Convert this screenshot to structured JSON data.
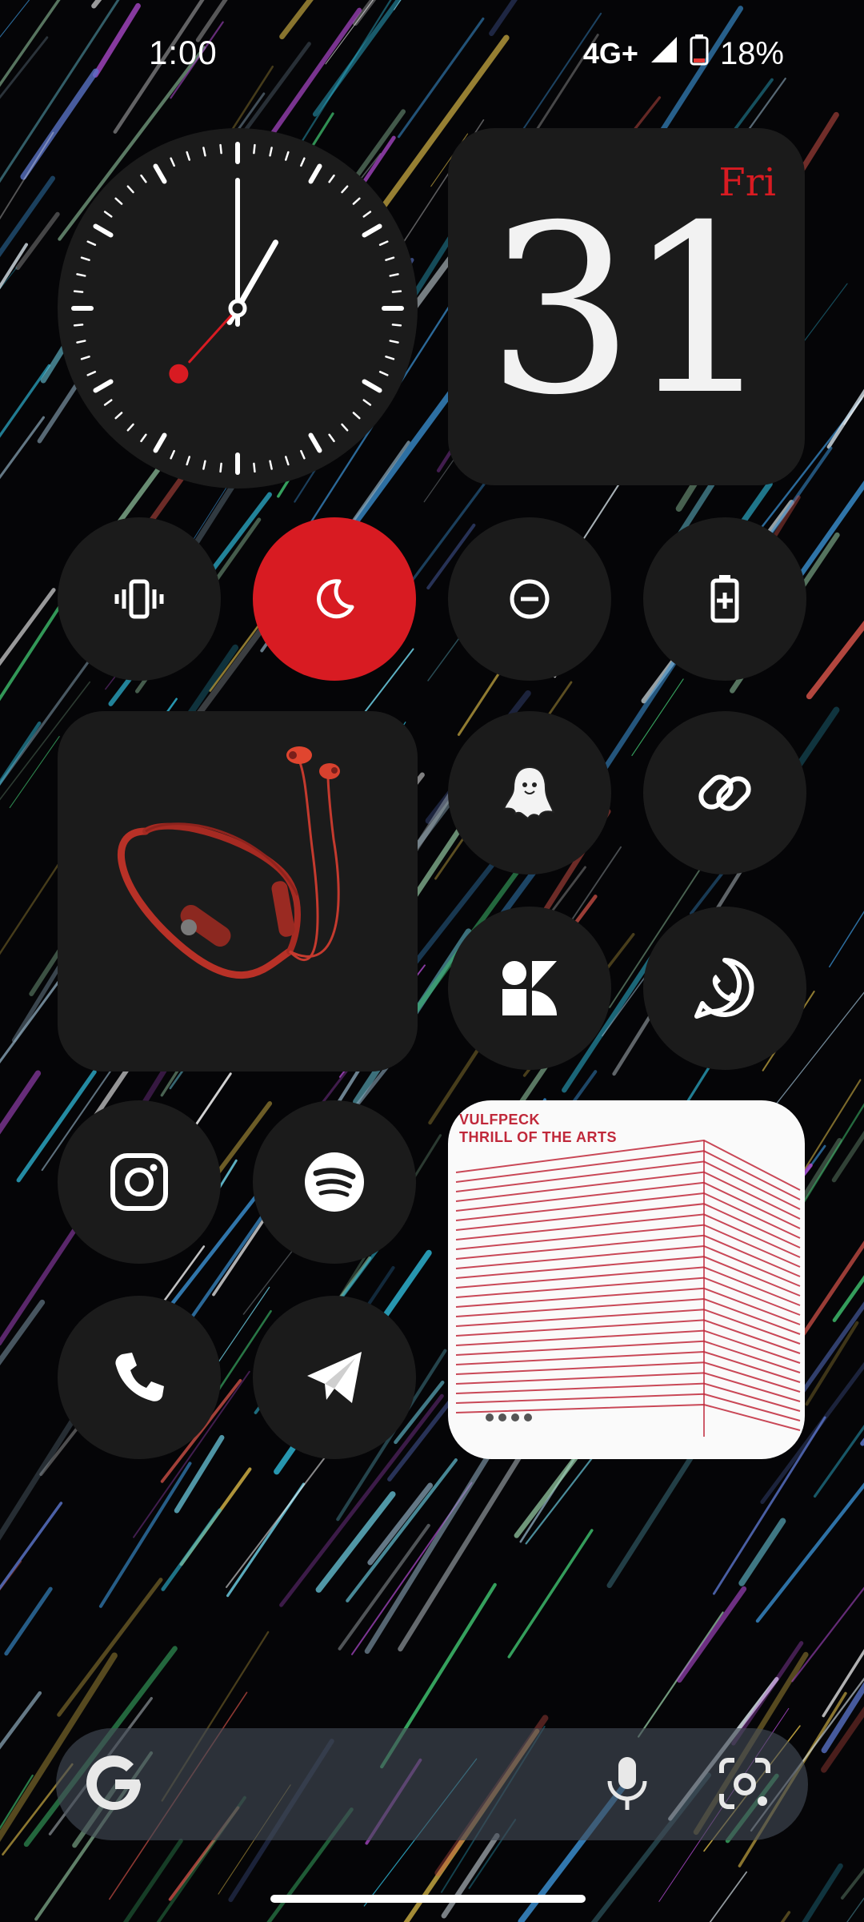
{
  "status_bar": {
    "time": "1:00",
    "network": "4G+",
    "battery": "18%"
  },
  "clock_widget": {
    "hours": 1,
    "minutes": 0,
    "seconds": 37,
    "accent_color": "#d81b22"
  },
  "date_widget": {
    "weekday": "Fri",
    "day": "31",
    "weekday_color": "#d81b22"
  },
  "quick_toggles": [
    {
      "name": "vibrate",
      "icon": "vibrate-icon",
      "active": false
    },
    {
      "name": "bedtime",
      "icon": "moon-icon",
      "active": true
    },
    {
      "name": "do-not-disturb",
      "icon": "minus-circle-icon",
      "active": false
    },
    {
      "name": "battery-saver",
      "icon": "battery-plus-icon",
      "active": false
    }
  ],
  "apps": [
    {
      "name": "ghost-app",
      "icon": "ghost-icon"
    },
    {
      "name": "clipboard-app",
      "icon": "link-icon"
    },
    {
      "name": "shapes-app",
      "icon": "shapes-icon"
    },
    {
      "name": "whatsapp",
      "icon": "whatsapp-icon"
    },
    {
      "name": "instagram",
      "icon": "instagram-icon"
    },
    {
      "name": "spotify",
      "icon": "spotify-icon"
    },
    {
      "name": "phone",
      "icon": "phone-icon"
    },
    {
      "name": "telegram",
      "icon": "telegram-icon"
    }
  ],
  "product_widget": {
    "image": "neckband-earphones",
    "color": "#c23a2e"
  },
  "album_widget": {
    "artist": "VULFPECK",
    "title": "THRILL OF THE ARTS",
    "accent_color": "#c0283a"
  },
  "search_bar": {
    "logo": "google-g-icon",
    "mic_icon": "mic-icon",
    "lens_icon": "camera-lens-icon"
  },
  "colors": {
    "accent_red": "#d81b22",
    "card_bg": "#1b1b1b"
  }
}
